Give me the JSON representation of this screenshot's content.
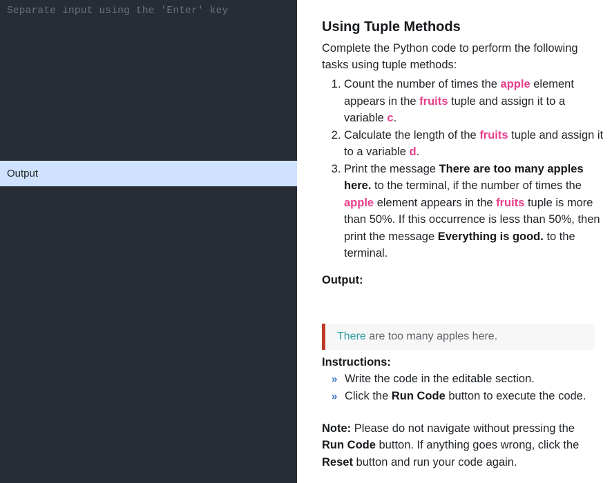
{
  "console": {
    "stdin_placeholder": "Separate input using the 'Enter' key",
    "output_tab_label": "Output",
    "output_text": ""
  },
  "task": {
    "title": "Using Tuple Methods",
    "intro": "Complete the Python code to perform the following tasks using tuple methods:",
    "steps": [
      {
        "parts": [
          {
            "text": "Count the number of times the ",
            "style": "plain"
          },
          {
            "text": "apple",
            "style": "code"
          },
          {
            "text": " element appears in the ",
            "style": "plain"
          },
          {
            "text": "fruits",
            "style": "code"
          },
          {
            "text": " tuple and assign it to a variable ",
            "style": "plain"
          },
          {
            "text": "c",
            "style": "code"
          },
          {
            "text": ".",
            "style": "plain"
          }
        ]
      },
      {
        "parts": [
          {
            "text": "Calculate the length of the ",
            "style": "plain"
          },
          {
            "text": "fruits",
            "style": "code"
          },
          {
            "text": " tuple and assign it to a variable ",
            "style": "plain"
          },
          {
            "text": "d",
            "style": "code"
          },
          {
            "text": ".",
            "style": "plain"
          }
        ]
      },
      {
        "parts": [
          {
            "text": "Print the message ",
            "style": "plain"
          },
          {
            "text": "There are too many apples here.",
            "style": "bold"
          },
          {
            "text": " to the terminal, if the number of times the ",
            "style": "plain"
          },
          {
            "text": "apple",
            "style": "code"
          },
          {
            "text": " element appears in the ",
            "style": "plain"
          },
          {
            "text": "fruits",
            "style": "code"
          },
          {
            "text": " tuple is more than 50%. If this occurrence is less than 50%, then print the message ",
            "style": "plain"
          },
          {
            "text": "Everything is good.",
            "style": "bold"
          },
          {
            "text": " to the terminal.",
            "style": "plain"
          }
        ]
      }
    ],
    "output_heading": "Output:",
    "output_result": {
      "highlight": "There",
      "rest": " are too many apples here."
    },
    "instructions_heading": "Instructions:",
    "instructions": [
      {
        "bullet": "»",
        "parts": [
          {
            "text": "Write the code in the editable section.",
            "style": "plain"
          }
        ]
      },
      {
        "bullet": "»",
        "parts": [
          {
            "text": "Click the ",
            "style": "plain"
          },
          {
            "text": "Run Code",
            "style": "bold"
          },
          {
            "text": " button to execute the code.",
            "style": "plain"
          }
        ]
      }
    ],
    "note": {
      "parts": [
        {
          "text": "Note:",
          "style": "bold"
        },
        {
          "text": " Please do not navigate without pressing the ",
          "style": "plain"
        },
        {
          "text": "Run Code",
          "style": "bold"
        },
        {
          "text": " button. If anything goes wrong, click the ",
          "style": "plain"
        },
        {
          "text": "Reset",
          "style": "bold"
        },
        {
          "text": " button and run your code again.",
          "style": "plain"
        }
      ]
    }
  },
  "colors": {
    "console_bg": "#282c34",
    "tab_active_bg": "#cfe2ff",
    "code_term": "#e83e8c",
    "output_border": "#c0392b",
    "output_highlight": "#2a9d9d",
    "bullet": "#2a6ebb"
  }
}
